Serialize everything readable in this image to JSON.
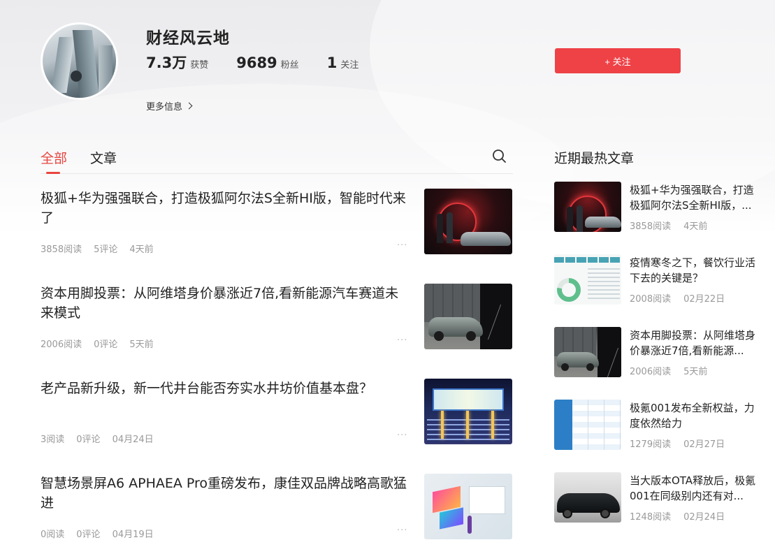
{
  "profile": {
    "name": "财经风云地",
    "stats": [
      {
        "value": "7.3万",
        "label": "获赞"
      },
      {
        "value": "9689",
        "label": "粉丝"
      },
      {
        "value": "1",
        "label": "关注"
      }
    ],
    "more_info": "更多信息",
    "follow_label": "+ 关注"
  },
  "tabs": {
    "all": "全部",
    "articles": "文章"
  },
  "feed": [
    {
      "title": "极狐+华为强强联合，打造极狐阿尔法S全新HI版，智能时代来了",
      "reads": "3858阅读",
      "comments": "5评论",
      "time": "4天前",
      "more": "···"
    },
    {
      "title": "资本用脚投票：从阿维塔身价暴涨近7倍,看新能源汽车赛道未来模式",
      "reads": "2006阅读",
      "comments": "0评论",
      "time": "5天前",
      "more": "···"
    },
    {
      "title": "老产品新升级，新一代井台能否夯实水井坊价值基本盘？",
      "reads": "3阅读",
      "comments": "0评论",
      "time": "04月24日",
      "more": "···"
    },
    {
      "title": "智慧场景屏A6 APHAEA Pro重磅发布，康佳双品牌战略高歌猛进",
      "reads": "0阅读",
      "comments": "0评论",
      "time": "04月19日",
      "more": "···"
    }
  ],
  "sidebar": {
    "title": "近期最热文章",
    "items": [
      {
        "title": "极狐+华为强强联合，打造极狐阿尔法S全新HI版，...",
        "reads": "3858阅读",
        "time": "4天前"
      },
      {
        "title": "疫情寒冬之下，餐饮行业活下去的关键是？",
        "reads": "2008阅读",
        "time": "02月22日"
      },
      {
        "title": "资本用脚投票：从阿维塔身价暴涨近7倍,看新能源...",
        "reads": "2006阅读",
        "time": "5天前"
      },
      {
        "title": "极氪001发布全新权益，力度依然给力",
        "reads": "1279阅读",
        "time": "02月27日"
      },
      {
        "title": "当大版本OTA释放后，极氪001在同级别内还有对...",
        "reads": "1248阅读",
        "time": "02月24日"
      }
    ]
  },
  "icons": {
    "search": "search-icon",
    "chevron": "chevron-right-icon",
    "more": "more-dots-icon"
  },
  "colors": {
    "accent": "#ee4247",
    "active_tab": "#e9453f",
    "meta_text": "#999999"
  }
}
